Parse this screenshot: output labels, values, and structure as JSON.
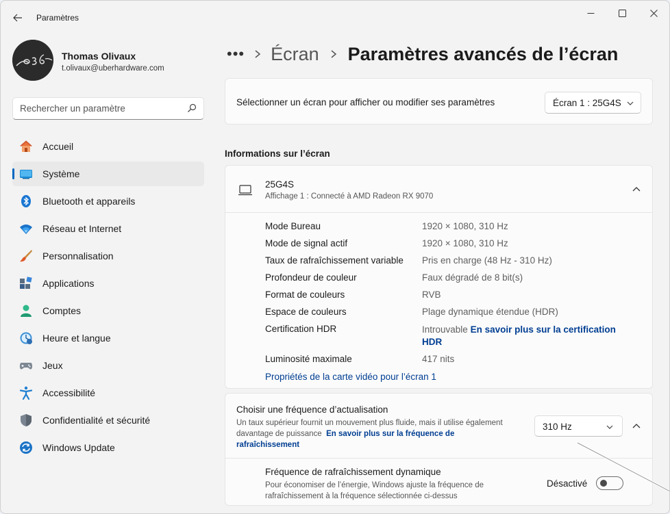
{
  "window": {
    "title": "Paramètres"
  },
  "profile": {
    "name": "Thomas Olivaux",
    "email": "t.olivaux@uberhardware.com",
    "avatar_text": "036"
  },
  "search": {
    "placeholder": "Rechercher un paramètre"
  },
  "nav": {
    "items": [
      {
        "label": "Accueil",
        "icon": "home-icon"
      },
      {
        "label": "Système",
        "icon": "system-icon",
        "active": true
      },
      {
        "label": "Bluetooth et appareils",
        "icon": "bluetooth-icon"
      },
      {
        "label": "Réseau et Internet",
        "icon": "wifi-icon"
      },
      {
        "label": "Personnalisation",
        "icon": "brush-icon"
      },
      {
        "label": "Applications",
        "icon": "apps-icon"
      },
      {
        "label": "Comptes",
        "icon": "account-icon"
      },
      {
        "label": "Heure et langue",
        "icon": "clock-globe-icon"
      },
      {
        "label": "Jeux",
        "icon": "gamepad-icon"
      },
      {
        "label": "Accessibilité",
        "icon": "accessibility-icon"
      },
      {
        "label": "Confidentialité et sécurité",
        "icon": "shield-icon"
      },
      {
        "label": "Windows Update",
        "icon": "update-icon"
      }
    ]
  },
  "breadcrumb": {
    "more": "•••",
    "parent": "Écran",
    "current": "Paramètres avancés de l’écran"
  },
  "display_select": {
    "label": "Sélectionner un écran pour afficher ou modifier ses paramètres",
    "value": "Écran 1 : 25G4S"
  },
  "info": {
    "section_title": "Informations sur l’écran",
    "monitor_name": "25G4S",
    "monitor_sub": "Affichage 1 : Connecté à AMD Radeon RX 9070",
    "rows": [
      {
        "label": "Mode Bureau",
        "value": "1920 × 1080, 310 Hz"
      },
      {
        "label": "Mode de signal actif",
        "value": "1920 × 1080, 310 Hz"
      },
      {
        "label": "Taux de rafraîchissement variable",
        "value": "Pris en charge (48 Hz - 310 Hz)"
      },
      {
        "label": "Profondeur de couleur",
        "value": "Faux dégradé de 8 bit(s)"
      },
      {
        "label": "Format de couleurs",
        "value": "RVB"
      },
      {
        "label": "Espace de couleurs",
        "value": "Plage dynamique étendue (HDR)"
      }
    ],
    "hdr_label": "Certification HDR",
    "hdr_value": "Introuvable",
    "hdr_link_1": "En savoir plus sur la certification",
    "hdr_link_2": "HDR",
    "lum_label": "Luminosité maximale",
    "lum_value": "417 nits",
    "gpu_link": "Propriétés de la carte vidéo pour l’écran 1"
  },
  "refresh": {
    "title": "Choisir une fréquence d’actualisation",
    "desc": "Un taux supérieur fournit un mouvement plus fluide, mais il utilise également davantage de puissance",
    "link": "En savoir plus sur la fréquence de rafraîchissement",
    "value": "310 Hz",
    "dynamic_title": "Fréquence de rafraîchissement dynamique",
    "dynamic_desc": "Pour économiser de l’énergie, Windows ajuste la fréquence de rafraîchissement à la fréquence sélectionnée ci-dessus",
    "toggle_state": "Désactivé",
    "toggle_on": false
  },
  "colors": {
    "accent": "#0067c0",
    "link": "#003e92"
  }
}
